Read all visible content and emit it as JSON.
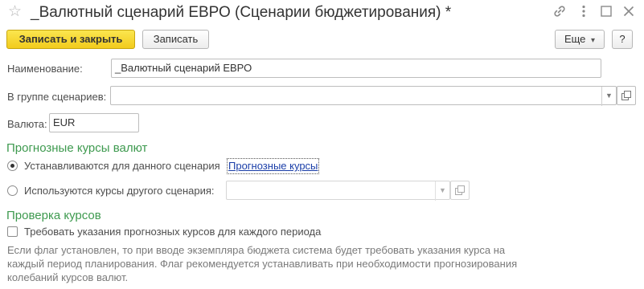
{
  "window": {
    "title": "_Валютный сценарий ЕВРО (Сценарии бюджетирования) *",
    "favorite_icon": "star-icon",
    "title_icons": [
      "link-icon",
      "more-vertical-icon",
      "maximize-icon",
      "close-icon"
    ]
  },
  "toolbar": {
    "save_close_label": "Записать и закрыть",
    "save_label": "Записать",
    "more_label": "Еще",
    "more_arrow": "▾",
    "help_label": "?"
  },
  "form": {
    "name_label": "Наименование:",
    "name_value": "_Валютный сценарий ЕВРО",
    "group_label": "В группе сценариев:",
    "group_value": "",
    "currency_label": "Валюта:",
    "currency_value": "EUR"
  },
  "forecast": {
    "section_title": "Прогнозные курсы валют",
    "option_own_label": "Устанавливаются для данного сценария",
    "option_own_selected": true,
    "rates_link": "Прогнозные курсы",
    "option_other_label": "Используются курсы другого сценария:",
    "option_other_selected": false,
    "other_scenario_value": ""
  },
  "check": {
    "section_title": "Проверка курсов",
    "require_label": "Требовать указания прогнозных курсов для каждого периода",
    "require_checked": false,
    "hint_text": "Если флаг установлен, то при вводе экземпляра бюджета система будет требовать указания курса на каждый период планирования. Флаг рекомендуется устанавливать при необходимости прогнозирования колебаний курсов валют."
  },
  "colors": {
    "section_title": "#3e9a4f",
    "primary_button": "#f5d423",
    "link": "#1a3ea8"
  }
}
